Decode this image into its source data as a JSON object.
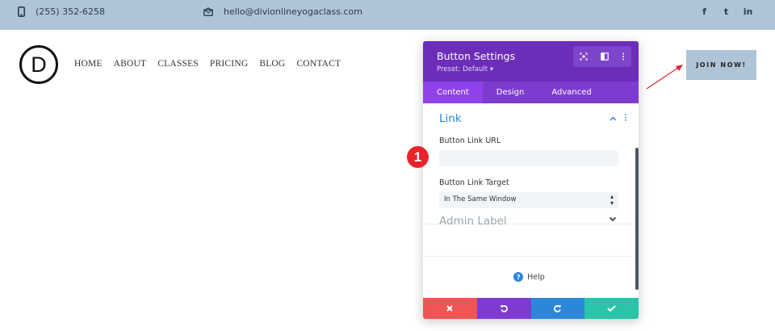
{
  "topbar": {
    "phone": "(255) 352-6258",
    "email": "hello@divionlineyogaclass.com",
    "social": [
      "f",
      "t",
      "in"
    ]
  },
  "logo": {
    "letter": "D"
  },
  "nav": {
    "items": [
      "HOME",
      "ABOUT",
      "CLASSES",
      "PRICING",
      "BLOG",
      "CONTACT"
    ]
  },
  "cta": {
    "label": "JOIN NOW!"
  },
  "panel": {
    "title": "Button Settings",
    "preset": "Preset: Default ▾",
    "header_icons": [
      "focus-icon",
      "columns-icon",
      "more-vertical-icon"
    ],
    "tabs": [
      "Content",
      "Design",
      "Advanced"
    ],
    "active_tab": "Content",
    "section_link": {
      "title": "Link",
      "url_label": "Button Link URL",
      "url_value": "",
      "target_label": "Button Link Target",
      "target_value": "In The Same Window"
    },
    "section_admin": {
      "title": "Admin Label"
    },
    "help": "Help",
    "footer_colors": [
      "#ef5555",
      "#7e3bd0",
      "#2b87da",
      "#29c4a9"
    ]
  },
  "badge": {
    "number": "1"
  },
  "colors": {
    "accent": "#6c2eb9",
    "link_blue": "#2b87da",
    "topbar": "#b0c4d8"
  }
}
